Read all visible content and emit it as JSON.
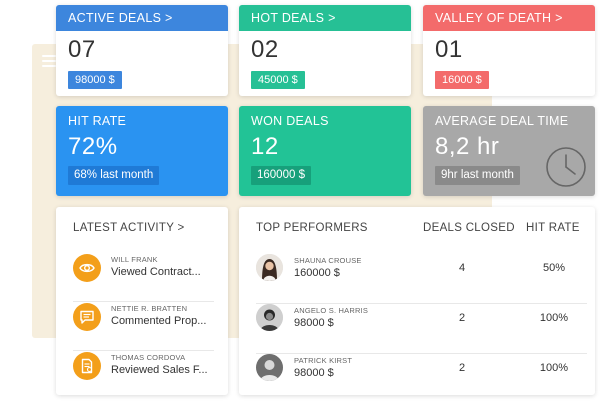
{
  "deal_cards": [
    {
      "title": "ACTIVE DEALS >",
      "count": "07",
      "amount": "98000 $",
      "color": "#3d86dd"
    },
    {
      "title": "HOT DEALS >",
      "count": "02",
      "amount": "45000 $",
      "color": "#26c095"
    },
    {
      "title": "VALLEY OF DEATH >",
      "count": "01",
      "amount": "16000 $",
      "color": "#f36b6b"
    }
  ],
  "metrics": [
    {
      "label": "HIT RATE",
      "value": "72%",
      "badge": "68% last month",
      "color": "#2a93f1"
    },
    {
      "label": "WON DEALS",
      "value": "12",
      "badge": "160000 $",
      "color": "#22c396"
    },
    {
      "label": "AVERAGE DEAL TIME",
      "value": "8,2 hr",
      "badge": "9hr last month",
      "color": "#a8a8a8",
      "icon": "clock-icon"
    }
  ],
  "latest_activity": {
    "title": "LATEST ACTIVITY >",
    "items": [
      {
        "name": "WILL FRANK",
        "action": "Viewed Contract...",
        "icon": "eye-icon"
      },
      {
        "name": "NETTIE R. BRATTEN",
        "action": "Commented Prop...",
        "icon": "comment-icon"
      },
      {
        "name": "THOMAS CORDOVA",
        "action": "Reviewed Sales F...",
        "icon": "document-icon"
      }
    ],
    "icon_color": "#f39f1a"
  },
  "top_performers": {
    "headers": {
      "name": "TOP PERFORMERS",
      "deals": "DEALS CLOSED",
      "rate": "HIT RATE"
    },
    "rows": [
      {
        "name": "SHAUNA CROUSE",
        "amount": "160000 $",
        "deals": "4",
        "rate": "50%"
      },
      {
        "name": "ANGELO S. HARRIS",
        "amount": "98000 $",
        "deals": "2",
        "rate": "100%"
      },
      {
        "name": "PATRICK KIRST",
        "amount": "98000 $",
        "deals": "2",
        "rate": "100%"
      }
    ]
  }
}
